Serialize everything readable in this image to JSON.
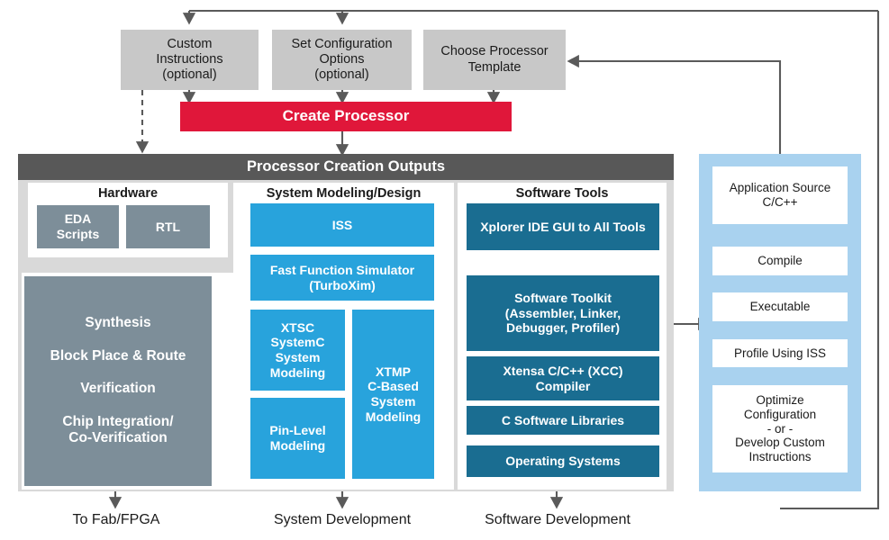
{
  "diagram": {
    "title": "Processor Creation Outputs",
    "inputs": [
      {
        "id": "custom-instructions",
        "label": "Custom\nInstructions\n(optional)"
      },
      {
        "id": "set-configuration-options",
        "label": "Set Configuration\nOptions\n(optional)"
      },
      {
        "id": "choose-processor-template",
        "label": "Choose Processor\nTemplate"
      }
    ],
    "action": {
      "id": "create-processor",
      "label": "Create Processor"
    },
    "groups": [
      {
        "id": "hardware",
        "title": "Hardware",
        "items": [
          {
            "id": "eda-scripts",
            "label": "EDA\nScripts"
          },
          {
            "id": "rtl",
            "label": "RTL"
          }
        ],
        "flow": [
          "Synthesis",
          "Block Place & Route",
          "Verification",
          "Chip Integration/\nCo-Verification"
        ],
        "caption": "To Fab/FPGA"
      },
      {
        "id": "system-modeling-design",
        "title": "System Modeling/Design",
        "items": [
          {
            "id": "iss",
            "label": "ISS"
          },
          {
            "id": "fast-function-simulator",
            "label": "Fast Function Simulator\n(TurboXim)"
          },
          {
            "id": "xtsc-systemc",
            "label": "XTSC\nSystemC\nSystem\nModeling"
          },
          {
            "id": "pin-level-modeling",
            "label": "Pin-Level\nModeling"
          },
          {
            "id": "xtmp-c-based",
            "label": "XTMP\nC-Based\nSystem\nModeling"
          }
        ],
        "caption": "System Development"
      },
      {
        "id": "software-tools",
        "title": "Software Tools",
        "items": [
          {
            "id": "xplorer-ide",
            "label": "Xplorer IDE GUI to All Tools"
          },
          {
            "id": "software-toolkit",
            "label": "Software Toolkit\n(Assembler, Linker,\nDebugger, Profiler)"
          },
          {
            "id": "xcc-compiler",
            "label": "Xtensa C/C++ (XCC)\nCompiler"
          },
          {
            "id": "c-software-libraries",
            "label": "C Software Libraries"
          },
          {
            "id": "operating-systems",
            "label": "Operating Systems"
          }
        ],
        "caption": "Software Development"
      }
    ],
    "software_development_flow": [
      {
        "id": "application-source",
        "label": "Application Source\nC/C++"
      },
      {
        "id": "compile",
        "label": "Compile"
      },
      {
        "id": "executable",
        "label": "Executable"
      },
      {
        "id": "profile-using-iss",
        "label": "Profile Using ISS"
      },
      {
        "id": "optimize-configuration",
        "label": "Optimize\nConfiguration\n- or -\nDevelop Custom\nInstructions"
      }
    ],
    "colors": {
      "red": "#e0173a",
      "gray_box": "#c8c8c8",
      "dark_header": "#585858",
      "panel_gray": "#d9d9d9",
      "slate": "#7d8e99",
      "light_blue": "#28a3dc",
      "dark_blue": "#1a6d91",
      "pale_blue": "#a9d2ef",
      "arrow": "#5a5a5a"
    }
  }
}
